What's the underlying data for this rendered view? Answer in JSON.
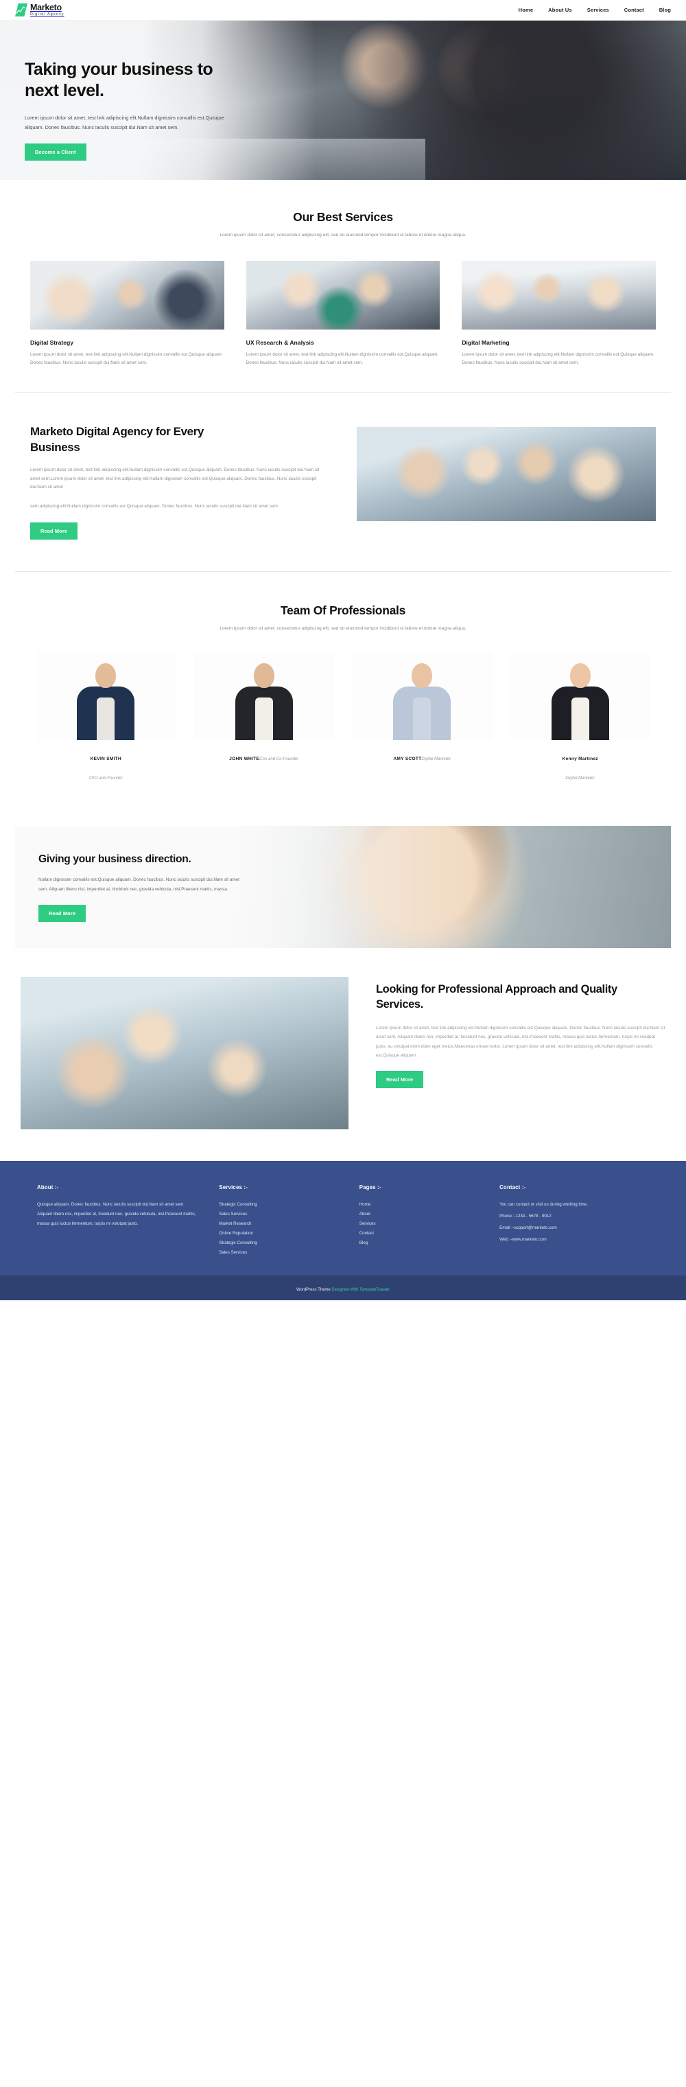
{
  "header": {
    "brand": {
      "name": "Marketo",
      "tagline": "Digital Agency",
      "logo_icon": "chart-arrow-logo-icon"
    },
    "nav": [
      {
        "label": "Home"
      },
      {
        "label": "About Us"
      },
      {
        "label": "Services"
      },
      {
        "label": "Contact"
      },
      {
        "label": "Blog"
      }
    ]
  },
  "hero": {
    "title": "Taking your business to next level.",
    "paragraph": "Lorem ipsum dolor sit amet, test link adipiscing elit.Nullam dignissim convallis est.Quisque aliquam. Donec faucibus. Nunc iaculis suscipit dui.Nam sit amet sem.",
    "cta_label": "Become a Client"
  },
  "services": {
    "title": "Our Best Services",
    "subtitle": "Lorem ipsum dolor sit amet, consectetur adipiscing elit, sed do eiusmod tempor incididunt ut labore et dolore magna aliqua.",
    "cards": [
      {
        "title": "Digital Strategy",
        "text": "Lorem ipsum dolor sit amet, test link adipiscing elit.Nullam dignissim convallis est.Quisque aliquam. Donec faucibus. Nunc iaculis suscipit dui.Nam sit amet sem.",
        "image": "team-meeting-photo"
      },
      {
        "title": "UX Research & Analysis",
        "text": "Lorem ipsum dolor sit amet, test link adipiscing elit.Nullam dignissim convallis est.Quisque aliquam. Donec faucibus. Nunc iaculis suscipit dui.Nam sit amet sem.",
        "image": "brainstorm-table-photo"
      },
      {
        "title": "Digital Marketing",
        "text": "Lorem ipsum dolor sit amet, test link adipiscing elit.Nullam dignissim convallis est.Quisque aliquam. Donec faucibus. Nunc iaculis suscipit dui.Nam sit amet sem.",
        "image": "celebrating-team-photo"
      }
    ]
  },
  "agency": {
    "title": "Marketo Digital Agency for Every Business",
    "paragraph1": "Lorem ipsum dolor sit amet, test link adipiscing elit.Nullam dignissim convallis est.Quisque aliquam. Donec faucibus. Nunc iaculis suscipit dui.Nam sit amet sem.Lorem ipsum dolor sit amet, test link adipiscing elit.Nullam dignissim convallis est.Quisque aliquam. Donec faucibus. Nunc iaculis suscipit dui.Nam sit amet",
    "paragraph2": "sem.adipiscing elit.Nullam dignissim convallis est.Quisque aliquam. Donec faucibus. Nunc iaculis suscipit dui.Nam sit amet sem.",
    "cta_label": "Read More",
    "image": "office-workshop-photo"
  },
  "team": {
    "title": "Team Of Professionals",
    "subtitle": "Lorem ipsum dolor sit amet, consectetur adipiscing elit, sed do eiusmod tempor incididunt ut labore et dolore magna aliqua.",
    "members": [
      {
        "name": "KEVIN SMITH",
        "role": "CEO and Founder",
        "layout": "stacked"
      },
      {
        "name": "JOHN WHITE",
        "role": "Coo and Co-Founder",
        "layout": "inline"
      },
      {
        "name": "AMY SCOTT",
        "role": "Digital Marketer",
        "layout": "inline"
      },
      {
        "name": "Kenny Martinez",
        "role": "Digital Marketer",
        "layout": "stacked"
      }
    ]
  },
  "direction": {
    "title": "Giving your business direction.",
    "paragraph": "Nullam dignissim convallis est.Quisque aliquam. Donec faucibus. Nunc iaculis suscipit dui.Nam sit amet sem. Aliquam libero nisi, imperdiet at, tincidunt nec, gravida vehicula, nisl.Praesent mattis, massa.",
    "cta_label": "Read More",
    "image": "smiling-woman-photo"
  },
  "looking": {
    "title": "Looking for Professional Approach and Quality Services.",
    "paragraph": "Lorem ipsum dolor sit amet, test link adipiscing elit.Nullam dignissim convallis est.Quisque aliquam. Donec faucibus. Nunc iaculis suscipit dui.Nam sit amet sem. Aliquam libero nisi, imperdiet at, tincidunt nec, gravida vehicula, nisl.Praesent mattis, massa quis luctus fermentum, turpis mi volutpat justo, eu volutpat enim diam eget metus.Maecenas ornare tortor. Lorem ipsum dolor sit amet, test link adipiscing elit.Nullam dignissim convallis est.Quisque aliquam.",
    "cta_label": "Read More",
    "image": "coworking-team-photo"
  },
  "footer": {
    "about": {
      "heading": "About :-",
      "text": "Quisque aliquam. Donec faucibus. Nunc iaculis suscipit dui.Nam sit amet sem. Aliquam libero nisi, imperdiet at, tincidunt nec, gravida vehicula, nisl.Praesent mattis, massa quis luctus fermentum, turpis mi volutpat justo."
    },
    "services": {
      "heading": "Services :-",
      "items": [
        "Strategic Consulting",
        "Sales Services",
        "Market Research",
        "Online Reputation",
        "Strategic Consulting",
        "Sales Services"
      ]
    },
    "pages": {
      "heading": "Pages :-",
      "items": [
        "Home",
        "About",
        "Services",
        "Contact",
        "Blog"
      ]
    },
    "contact": {
      "heading": "Contact :-",
      "intro": "You can contact or visit us during working time.",
      "phone": "Phone :-1234 - 5678 - 9012",
      "email": "Email :-support@marketo.com",
      "web": "Web :-www.marketo.com"
    },
    "bottom": {
      "prefix": "WordPress Theme ",
      "link": "Designed With TemplateToaster"
    }
  },
  "colors": {
    "accent_green": "#2ecc82",
    "footer_blue": "#39508c",
    "footer_bottom_blue": "#2e4170",
    "link_teal": "#39c6a0"
  }
}
